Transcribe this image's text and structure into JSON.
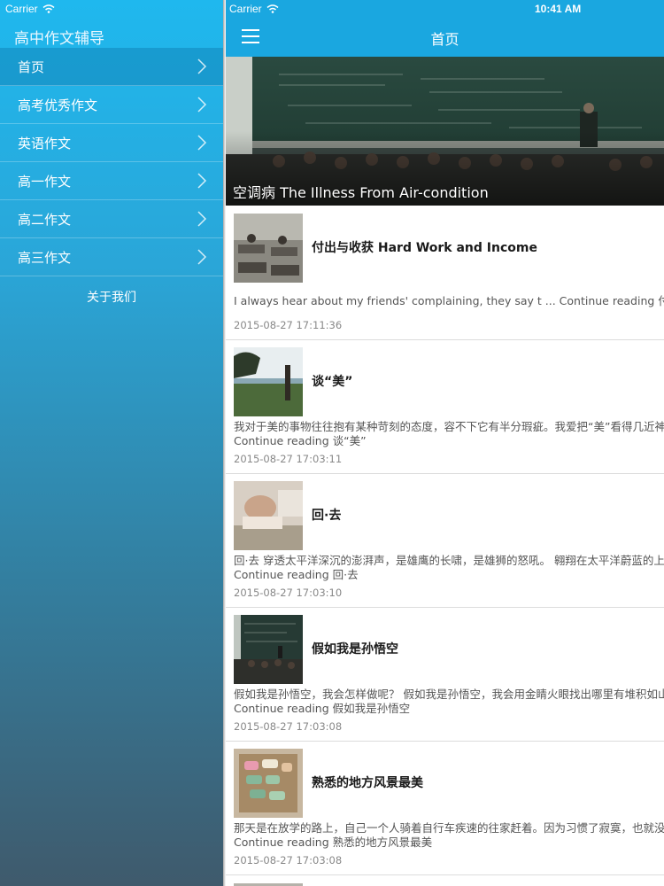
{
  "status": {
    "carrier": "Carrier",
    "time": "10:41 AM"
  },
  "sidebar": {
    "app_title": "高中作文辅导",
    "items": [
      {
        "label": "首页"
      },
      {
        "label": "高考优秀作文"
      },
      {
        "label": "英语作文"
      },
      {
        "label": "高一作文"
      },
      {
        "label": "高二作文"
      },
      {
        "label": "高三作文"
      }
    ],
    "about": "关于我们"
  },
  "navbar": {
    "title": "首页"
  },
  "hero": {
    "caption": "空调病 The Illness From Air-condition"
  },
  "articles": [
    {
      "title": "付出与收获 Hard Work and Income",
      "excerpt_1": "I always hear about my friends' complaining, they say t ... Continue reading 付出与收获 Hard Work and Income",
      "excerpt_2": "",
      "date": "2015-08-27 17:11:36"
    },
    {
      "title": "谈“美”",
      "excerpt_1": "我对于美的事物往往抱有某种苛刻的态度，容不下它有半分瑕疵。我爱把“美”看得几近神圣",
      "excerpt_2": "Continue reading 谈“美”",
      "date": "2015-08-27 17:03:11"
    },
    {
      "title": "回·去",
      "excerpt_1": "回·去 穿透太平洋深沉的澎湃声，是雄鹰的长啸，是雄狮的怒吼。 翱翔在太平洋蔚蓝的上空",
      "excerpt_2": "Continue reading 回·去",
      "date": "2015-08-27 17:03:10"
    },
    {
      "title": "假如我是孙悟空",
      "excerpt_1": "假如我是孙悟空，我会怎样做呢？ 假如我是孙悟空，我会用金睛火眼找出哪里有堆积如山",
      "excerpt_2": "Continue reading 假如我是孙悟空",
      "date": "2015-08-27 17:03:08"
    },
    {
      "title": "熟悉的地方风景最美",
      "excerpt_1": "那天是在放学的路上，自己一个人骑着自行车疾速的往家赶着。因为习惯了寂寞，也就没有",
      "excerpt_2": "Continue reading 熟悉的地方风景最美",
      "date": "2015-08-27 17:03:08"
    }
  ],
  "icons": {
    "menu": "hamburger-icon",
    "chevron": "chevron-right-icon",
    "wifi": "wifi-icon"
  }
}
